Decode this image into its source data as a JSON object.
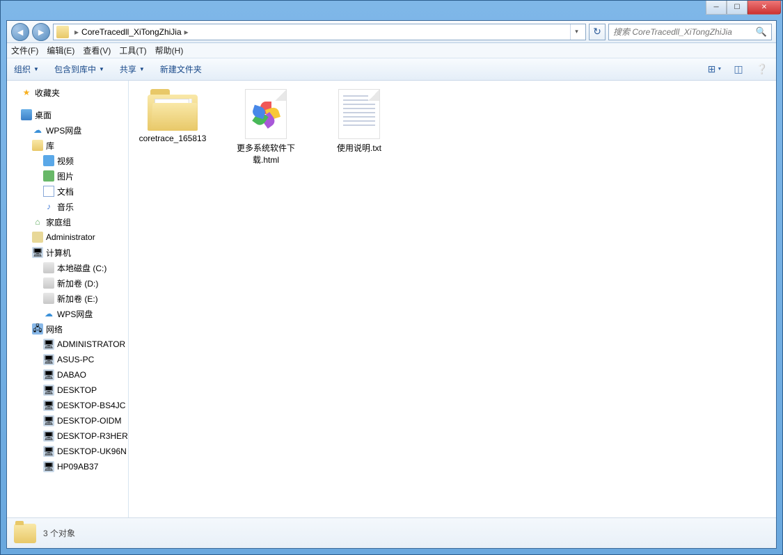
{
  "window": {
    "title": ""
  },
  "nav": {
    "path_segment": "CoreTracedll_XiTongZhiJia",
    "search_placeholder": "搜索 CoreTracedll_XiTongZhiJia"
  },
  "menu": {
    "file": "文件(F)",
    "edit": "编辑(E)",
    "view": "查看(V)",
    "tools": "工具(T)",
    "help": "帮助(H)"
  },
  "toolbar": {
    "organize": "组织",
    "include": "包含到库中",
    "share": "共享",
    "newfolder": "新建文件夹"
  },
  "sidebar": {
    "favorites": "收藏夹",
    "desktop": "桌面",
    "wps": "WPS网盘",
    "libraries": "库",
    "videos": "视频",
    "pictures": "图片",
    "documents": "文档",
    "music": "音乐",
    "homegroup": "家庭组",
    "admin": "Administrator",
    "computer": "计算机",
    "drive_c": "本地磁盘 (C:)",
    "drive_d": "新加卷 (D:)",
    "drive_e": "新加卷 (E:)",
    "wps2": "WPS网盘",
    "network": "网络",
    "pcs": [
      "ADMINISTRATOR",
      "ASUS-PC",
      "DABAO",
      "DESKTOP",
      "DESKTOP-BS4JC",
      "DESKTOP-OIDM",
      "DESKTOP-R3HER",
      "DESKTOP-UK96N",
      "HP09AB37"
    ]
  },
  "files": {
    "f1": "coretrace_165813",
    "f2": "更多系统软件下载.html",
    "f3": "使用说明.txt"
  },
  "status": {
    "count": "3 个对象"
  }
}
